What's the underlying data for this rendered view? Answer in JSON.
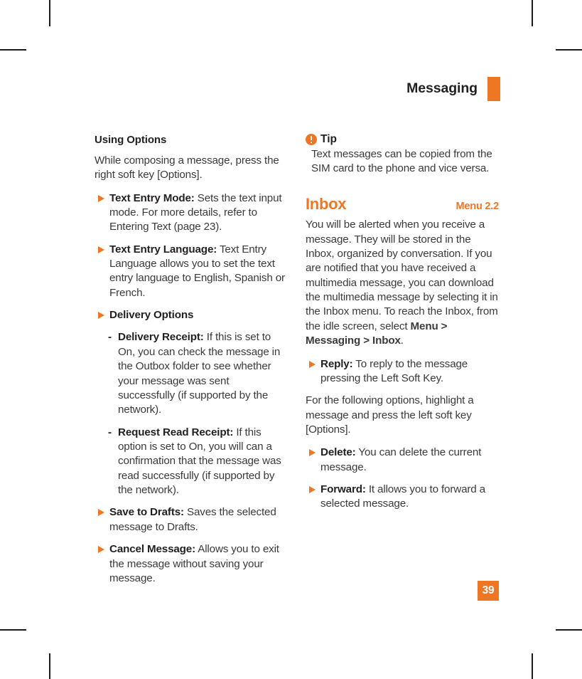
{
  "colors": {
    "accent": "#ef7622",
    "body_text": "#3a3a3a",
    "heading_text": "#231f20",
    "crop_mark": "#1b1b1b",
    "folio_text": "#ffffff"
  },
  "header": {
    "title": "Messaging",
    "rule_icon": "orange-rule-bar"
  },
  "left_column": {
    "heading": "Using Options",
    "intro": "While composing a message, press the right soft key [Options].",
    "bullets": [
      {
        "term": "Text Entry Mode:",
        "text": " Sets the text input mode. For more details, refer to Entering Text (page 23)."
      },
      {
        "term": "Text Entry Language:",
        "text": " Text Entry Language allows you to set the text entry language to English, Spanish or French."
      },
      {
        "term": "Delivery Options",
        "text": ""
      }
    ],
    "sub_items": [
      {
        "dash": "-",
        "term": "Delivery Receipt:",
        "text": " If this is set to On, you can check the message in the Outbox folder to see whether your message was sent successfully (if supported by the network)."
      },
      {
        "dash": "-",
        "term": "Request Read Receipt:",
        "text": " If this option is set to On, you will can a confirmation that the message was read successfully (if supported by the network)."
      }
    ],
    "bullets_tail": [
      {
        "term": "Save to Drafts:",
        "text": " Saves the selected message to Drafts."
      },
      {
        "term": "Cancel Message:",
        "text": " Allows you to exit the message without saving your message."
      }
    ]
  },
  "right_column": {
    "tip": {
      "icon": "exclamation-circle-icon",
      "title": "Tip",
      "body": "Text messages can be copied from the SIM card to the phone and vice versa."
    },
    "section": {
      "title": "Inbox",
      "menu_ref": "Menu 2.2",
      "intro_part1": "You will be alerted when you receive a message. They will be stored in the Inbox, organized by conversation. If you are notified that you have received a multimedia message, you can download the multimedia message by selecting it in the Inbox menu. To reach the Inbox, from the idle screen, select ",
      "intro_bold": "Menu > Messaging > Inbox",
      "intro_part2": "."
    },
    "bullets": [
      {
        "term": "Reply:",
        "text": " To reply to the message pressing the Left Soft Key."
      }
    ],
    "mid_paragraph": "For the following options, highlight a message and press the left soft key [Options].",
    "bullets_tail": [
      {
        "term": "Delete:",
        "text": " You can delete the current message."
      },
      {
        "term": "Forward:",
        "text": " It allows you to forward a selected message."
      }
    ]
  },
  "folio": {
    "page_number": "39"
  }
}
